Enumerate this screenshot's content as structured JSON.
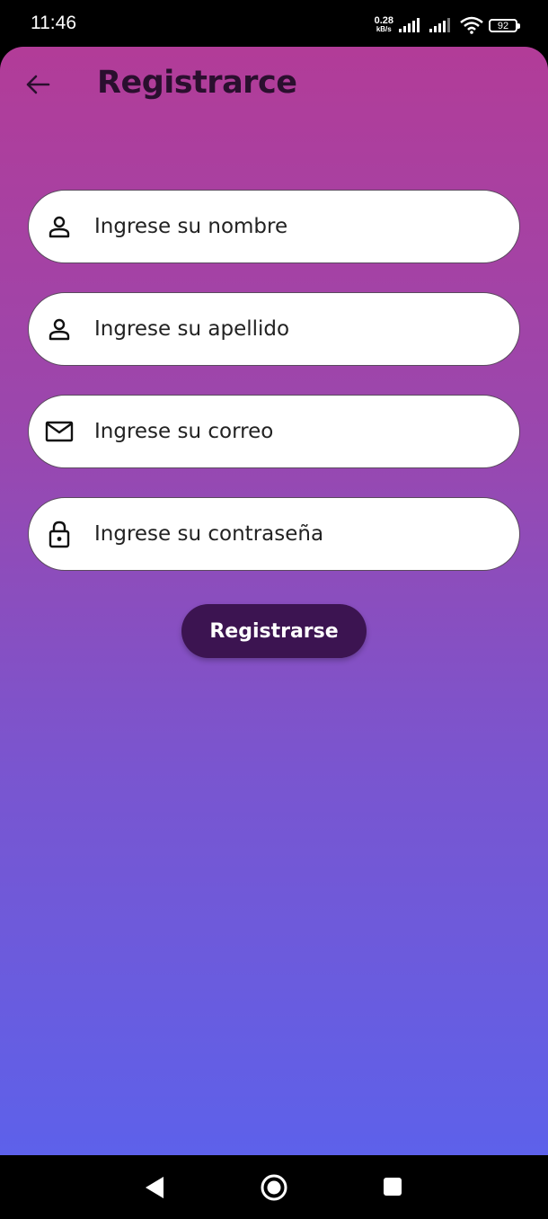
{
  "status_bar": {
    "time": "11:46",
    "net_speed_value": "0.28",
    "net_speed_unit": "kB/s",
    "battery": "92"
  },
  "header": {
    "title": "Registrarce",
    "back_icon": "arrow-left-icon"
  },
  "form": {
    "fields": [
      {
        "icon": "person-icon",
        "placeholder": "Ingrese su nombre",
        "value": ""
      },
      {
        "icon": "person-icon",
        "placeholder": "Ingrese su apellido",
        "value": ""
      },
      {
        "icon": "mail-icon",
        "placeholder": "Ingrese su correo",
        "value": ""
      },
      {
        "icon": "lock-icon",
        "placeholder": "Ingrese su contraseña",
        "value": ""
      }
    ],
    "submit_label": "Registrarse"
  },
  "colors": {
    "gradient_top": "#b23c98",
    "gradient_bottom": "#5d61ea",
    "button_bg": "#3c1451",
    "title_color": "#2a0f2e"
  },
  "nav_bar": {
    "back_icon": "triangle-back-icon",
    "home_icon": "circle-home-icon",
    "recents_icon": "square-recents-icon"
  }
}
